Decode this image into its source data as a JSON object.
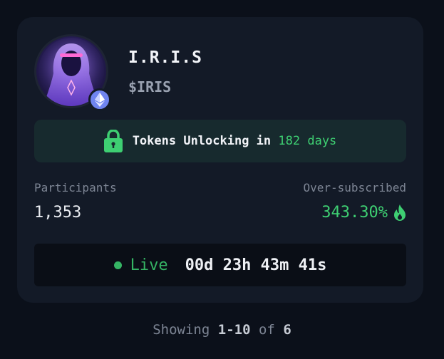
{
  "token": {
    "name": "I.R.I.S",
    "ticker": "$IRIS",
    "chain_icon": "ethereum-icon",
    "avatar": "hooded-figure-avatar"
  },
  "unlock": {
    "icon": "lock-icon",
    "prefix": "Tokens Unlocking in",
    "days": "182 days"
  },
  "stats": {
    "participants_label": "Participants",
    "participants_value": "1,353",
    "oversubscribed_label": "Over-subscribed",
    "oversubscribed_value": "343.30%",
    "oversubscribed_icon": "flame-icon"
  },
  "status": {
    "live_label": "Live",
    "countdown": "00d 23h 43m 41s"
  },
  "pagination": {
    "showing_label": "Showing",
    "range": "1-10",
    "of_label": "of",
    "total": "6"
  },
  "colors": {
    "background": "#0b101a",
    "card": "#131a27",
    "accent_green": "#3ecf72",
    "banner_bg": "#172a2e",
    "eth_badge": "#6f84f0"
  }
}
